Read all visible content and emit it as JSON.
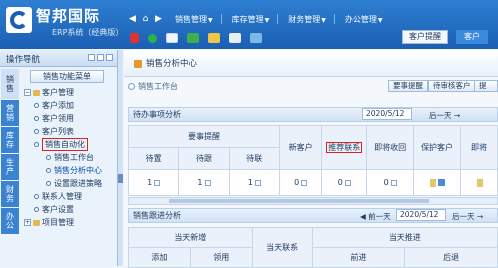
{
  "header": {
    "brand": "智邦国际",
    "sub": "ERP系统（经典版）",
    "menu": [
      {
        "label": "销售管理"
      },
      {
        "label": "库存管理"
      },
      {
        "label": "财务管理"
      },
      {
        "label": "办公管理"
      }
    ],
    "right_link": "客户提醒",
    "client_button": "客户"
  },
  "sidebar": {
    "title": "操作导航",
    "vertical_tabs": [
      "销售",
      "营销",
      "库存",
      "生产",
      "财务",
      "办公"
    ],
    "function_menu": "销售功能菜单",
    "tree": [
      {
        "label": "客户管理",
        "level": 0,
        "toggle": "-"
      },
      {
        "label": "客户添加",
        "level": 1
      },
      {
        "label": "客户领用",
        "level": 1
      },
      {
        "label": "客户列表",
        "level": 1
      },
      {
        "label": "销售自动化",
        "level": 1,
        "highlight": true
      },
      {
        "label": "销售工作台",
        "level": 2
      },
      {
        "label": "销售分析中心",
        "level": 2,
        "selected": true
      },
      {
        "label": "设置跟进策略",
        "level": 2
      },
      {
        "label": "联系人管理",
        "level": 1
      },
      {
        "label": "客户设置",
        "level": 1
      },
      {
        "label": "项目管理",
        "level": 0,
        "toggle": "+"
      }
    ]
  },
  "main": {
    "tab_title": "销售分析中心",
    "crumb": "销售工作台",
    "buttons": [
      "要事提醒",
      "待审核客户",
      "提醒设置"
    ],
    "todo": {
      "title": "待办事项分析",
      "date": "2020/5/12",
      "next_day": "后一天",
      "group_header": "要事提醒",
      "columns": [
        "待置",
        "待跟",
        "待联",
        "新客户",
        "推荐联系",
        "即将收回",
        "保护客户",
        "即将"
      ],
      "row": [
        "1",
        "1",
        "1",
        "0",
        "0",
        "0",
        "",
        ""
      ]
    },
    "followup": {
      "title": "销售跟进分析",
      "prev_day": "前一天",
      "date": "2020/5/12",
      "next_day": "后一天",
      "col_new": "当天新增",
      "col_contact": "当天联系",
      "col_push": "当天推进",
      "sub_headers": [
        "添加",
        "领用",
        "前进",
        "后退"
      ]
    }
  }
}
